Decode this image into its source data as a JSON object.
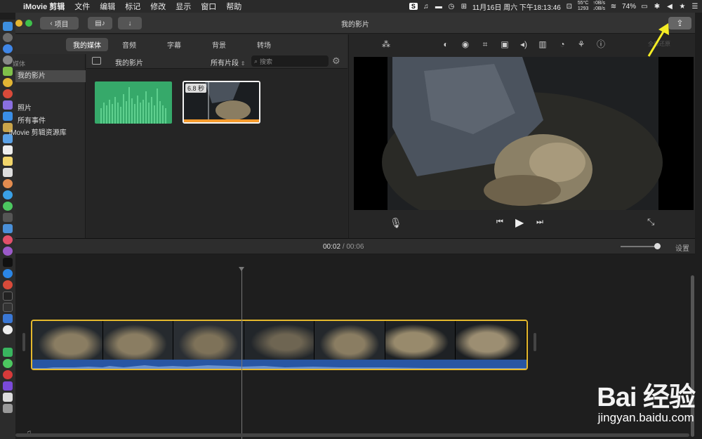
{
  "menubar": {
    "app_name": "iMovie 剪辑",
    "menus": [
      "文件",
      "编辑",
      "标记",
      "修改",
      "显示",
      "窗口",
      "帮助"
    ],
    "temp": "55°C",
    "rpm": "1293",
    "net_up": "0B/s",
    "net_down": "0B/s",
    "datetime": "11月16日 周六 下午18:13:46",
    "battery": "74%"
  },
  "window": {
    "title": "我的影片",
    "back_button": "项目"
  },
  "tabs": [
    "我的媒体",
    "音频",
    "字幕",
    "背景",
    "转场"
  ],
  "library": {
    "section_media": "媒体",
    "item_movie": "我的影片",
    "item_photos": "照片",
    "item_events": "所有事件",
    "item_library": "iMovie 剪辑资源库"
  },
  "browser": {
    "title": "我的影片",
    "filter": "所有片段",
    "search_placeholder": "搜索",
    "clip_duration": "6.8 秒"
  },
  "viewer": {
    "fullscreen_label": "全部还原"
  },
  "timeline": {
    "current_time": "00:02",
    "total_time": "00:06",
    "settings_label": "设置"
  },
  "watermark": {
    "logo": "Bai 经验",
    "url": "jingyan.baidu.com"
  },
  "colors": {
    "audio_clip": "#36a96a",
    "clip_border": "#e5b92d",
    "selection_orange": "#f59b2d",
    "arrow": "#f4ec25"
  }
}
